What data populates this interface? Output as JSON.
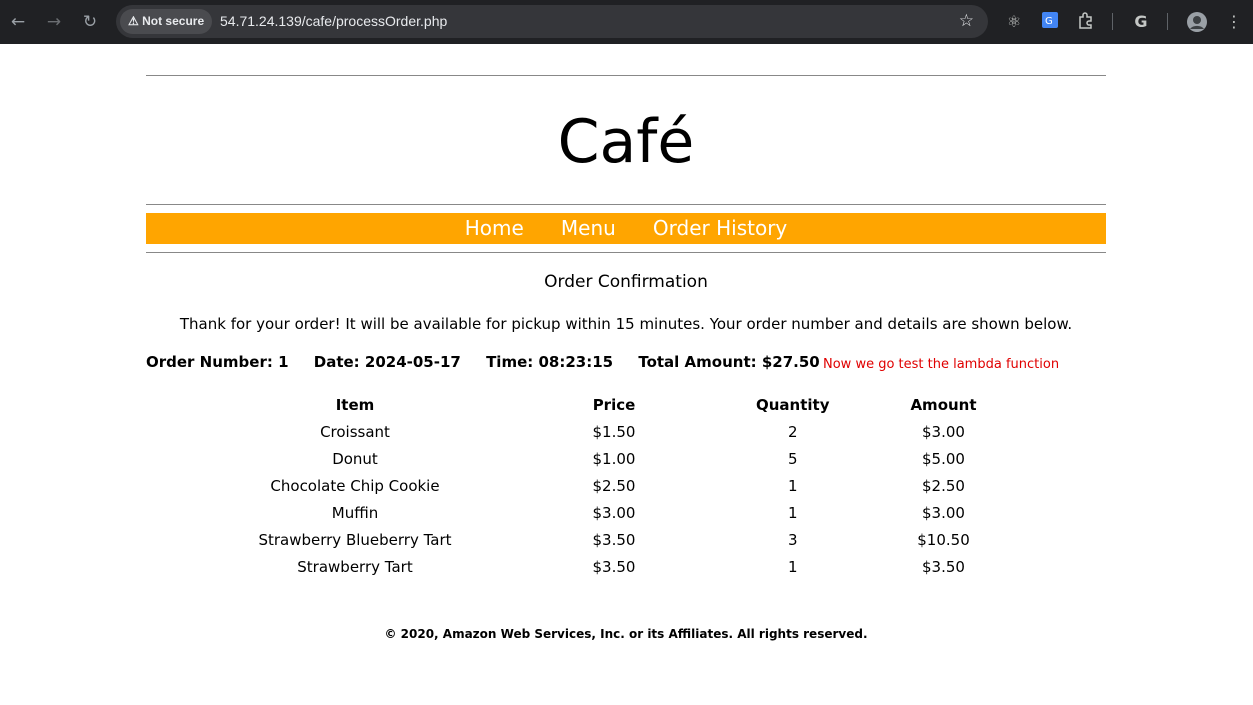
{
  "browser": {
    "security_label": "Not secure",
    "url": "54.71.24.139/cafe/processOrder.php"
  },
  "site": {
    "title": "Café",
    "nav": [
      "Home",
      "Menu",
      "Order History"
    ]
  },
  "order": {
    "heading": "Order Confirmation",
    "thanks": "Thank for your order! It will be available for pickup within 15 minutes. Your order number and details are shown below.",
    "number_label": "Order Number: 1",
    "date_label": "Date: 2024-05-17",
    "time_label": "Time: 08:23:15",
    "total_label": "Total Amount: $27.50",
    "note": "Now we go test the lambda function",
    "columns": [
      "Item",
      "Price",
      "Quantity",
      "Amount"
    ],
    "rows": [
      [
        "Croissant",
        "$1.50",
        "2",
        "$3.00"
      ],
      [
        "Donut",
        "$1.00",
        "5",
        "$5.00"
      ],
      [
        "Chocolate Chip Cookie",
        "$2.50",
        "1",
        "$2.50"
      ],
      [
        "Muffin",
        "$3.00",
        "1",
        "$3.00"
      ],
      [
        "Strawberry Blueberry Tart",
        "$3.50",
        "3",
        "$10.50"
      ],
      [
        "Strawberry Tart",
        "$3.50",
        "1",
        "$3.50"
      ]
    ]
  },
  "footer": "© 2020, Amazon Web Services, Inc. or its Affiliates. All rights reserved.",
  "colors": {
    "nav_bar": "#ffa500",
    "note": "#e00000",
    "chrome": "#202124"
  }
}
